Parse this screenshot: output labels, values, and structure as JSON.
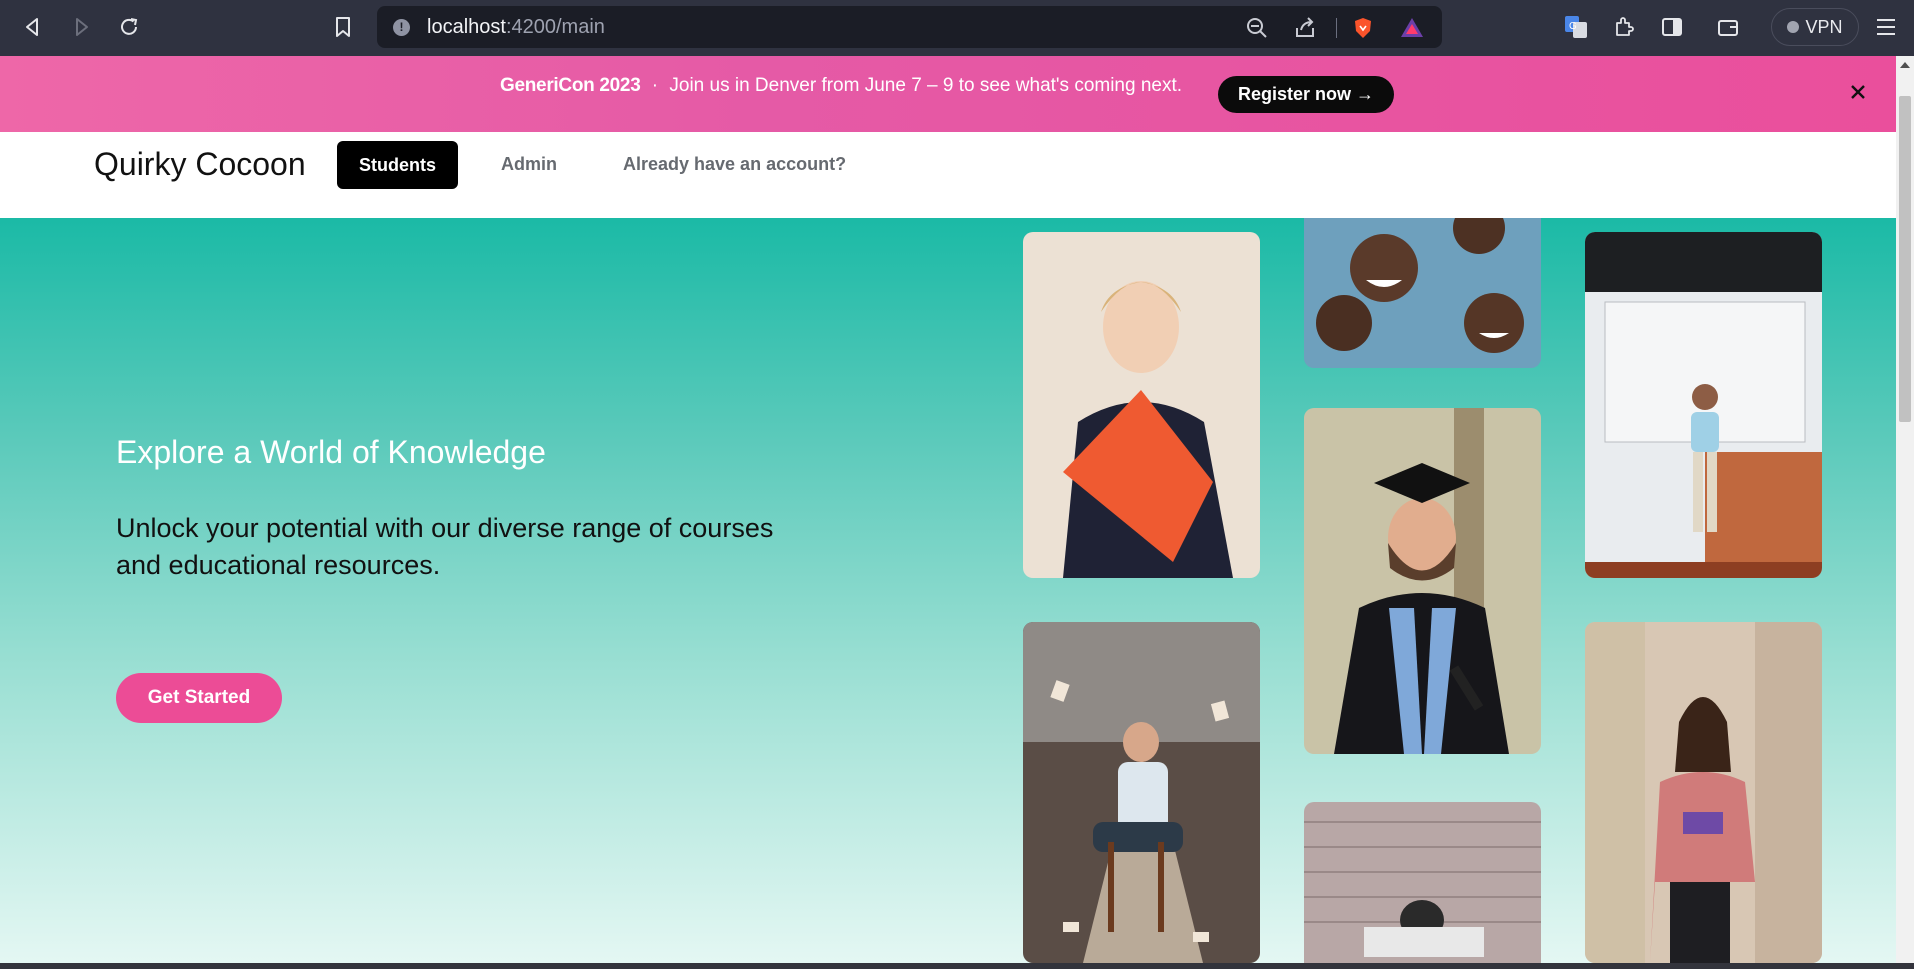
{
  "browser": {
    "url_host": "localhost",
    "url_path": ":4200/main",
    "vpn_label": "VPN"
  },
  "banner": {
    "event_name": "GeneriCon 2023",
    "separator": "·",
    "message": "Join us in Denver from June 7 – 9 to see what's coming next.",
    "register_label": "Register now →"
  },
  "navbar": {
    "brand": "Quirky Cocoon",
    "items": [
      {
        "label": "Students",
        "active": true
      },
      {
        "label": "Admin",
        "active": false
      },
      {
        "label": "Already have an account?",
        "active": false
      }
    ]
  },
  "hero": {
    "heading": "Explore a World of Knowledge",
    "subheading": "Unlock your potential with our diverse range of courses and educational resources.",
    "cta_label": "Get Started"
  },
  "gallery": [
    {
      "name": "woman-with-folder-photo"
    },
    {
      "name": "smiling-children-photo"
    },
    {
      "name": "teacher-in-classroom-photo"
    },
    {
      "name": "graduate-photo"
    },
    {
      "name": "man-with-book-on-head-photo"
    },
    {
      "name": "woman-reading-photo"
    },
    {
      "name": "brick-wall-photo"
    }
  ],
  "colors": {
    "banner": "#ea55a0",
    "cta": "#ec4c96",
    "hero_top": "#1bbaa6",
    "hero_bottom": "#e4f7f3"
  }
}
